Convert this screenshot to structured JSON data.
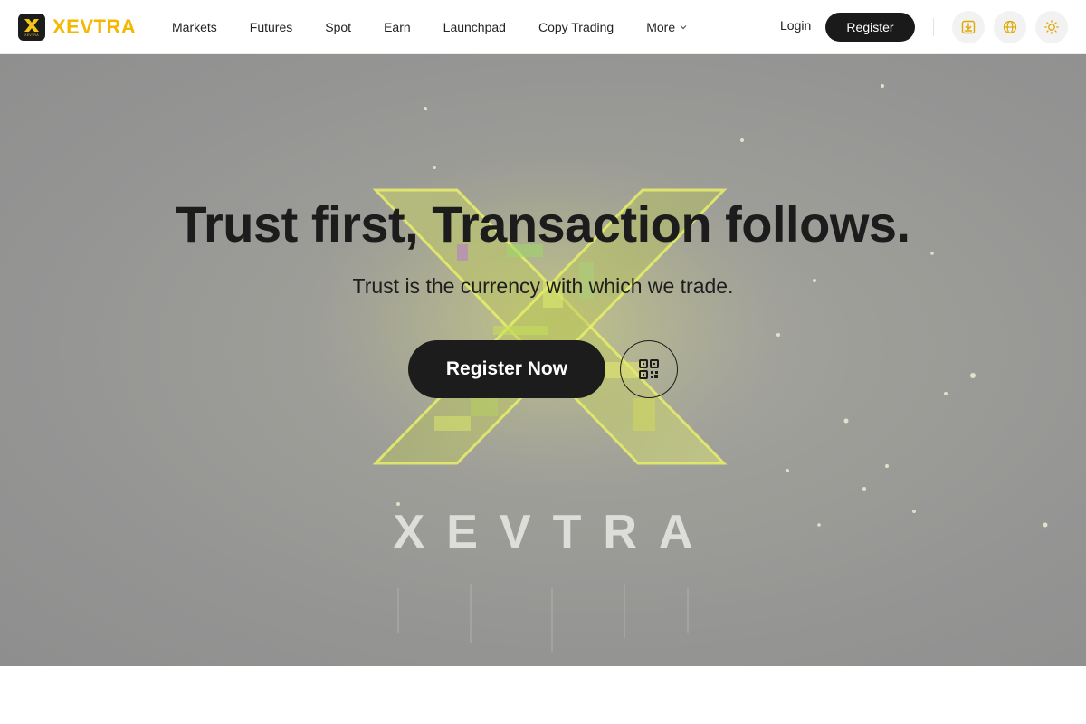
{
  "brand": {
    "name": "XEVTRA",
    "badge_text": "XEVTRA",
    "accent_color": "#F5B800",
    "dark_color": "#1A1A1A"
  },
  "nav": {
    "items": [
      {
        "label": "Markets"
      },
      {
        "label": "Futures"
      },
      {
        "label": "Spot"
      },
      {
        "label": "Earn"
      },
      {
        "label": "Launchpad"
      },
      {
        "label": "Copy Trading"
      },
      {
        "label": "More",
        "has_dropdown": true
      }
    ],
    "login_label": "Login",
    "register_label": "Register",
    "icons": [
      "download-icon",
      "globe-icon",
      "sun-icon"
    ]
  },
  "hero": {
    "title": "Trust first, Transaction follows.",
    "subtitle": "Trust is the currency with which we trade.",
    "cta_label": "Register Now",
    "qr_icon": "qr-code-icon",
    "background_brand_text": "XEVTRA"
  }
}
